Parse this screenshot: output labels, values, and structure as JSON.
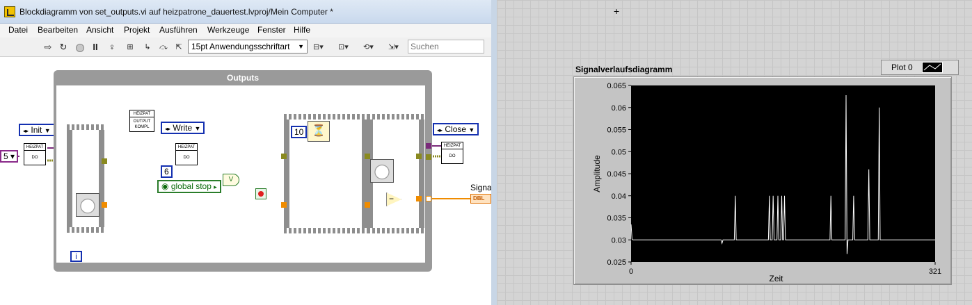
{
  "block_diagram": {
    "window_title": "Blockdiagramm von set_outputs.vi auf heizpatrone_dauertest.lvproj/Mein Computer *",
    "menu": [
      "Datei",
      "Bearbeiten",
      "Ansicht",
      "Projekt",
      "Ausführen",
      "Werkzeuge",
      "Fenster",
      "Hilfe"
    ],
    "toolbar": {
      "font_select": "15pt Anwendungsschriftart",
      "search_placeholder": "Suchen",
      "icons": [
        "run-arrow-icon",
        "run-continuous-icon",
        "abort-icon",
        "pause-icon",
        "highlight-bulb-icon",
        "retain-wire-icon",
        "step-into-icon",
        "step-over-icon",
        "step-out-icon",
        "align-icon",
        "distribute-icon",
        "resize-icon",
        "reorder-icon"
      ]
    },
    "diagram": {
      "loop_title": "Outputs",
      "init_enum": "Init",
      "write_enum": "Write",
      "close_enum": "Close",
      "subvi_label": "HEIZPAT",
      "subvi_sub": "DO",
      "output_subvi_line1": "OUTPUT",
      "output_subvi_line2": "KOMPL",
      "constant_six": "6",
      "constant_ten": "10",
      "global_stop": "global stop",
      "or_label": "V",
      "iteration_terminal": "i",
      "left_cut_constant": "5",
      "subtract_symbol": "−",
      "signal_label": "Signal",
      "signal_type": "DBL"
    }
  },
  "front_panel": {
    "graph_title": "Signalverlaufsdiagramm",
    "legend_plot": "Plot 0",
    "colors": {
      "plot_bg": "#000000",
      "trace": "#ffffff",
      "frame": "#c4c4c4"
    }
  },
  "chart_data": {
    "type": "line",
    "title": "Signalverlaufsdiagramm",
    "xlabel": "Zeit",
    "ylabel": "Amplitude",
    "xlim": [
      0,
      321
    ],
    "ylim": [
      0.025,
      0.065
    ],
    "x_ticks": [
      "0",
      "321"
    ],
    "y_ticks": [
      "0.025",
      "0.03",
      "0.035",
      "0.04",
      "0.045",
      "0.05",
      "0.055",
      "0.06",
      "0.065"
    ],
    "series": [
      {
        "name": "Plot 0",
        "baseline": 0.03,
        "points": [
          [
            0,
            0.0335
          ],
          [
            1,
            0.0302
          ],
          [
            2,
            0.03
          ],
          [
            50,
            0.03
          ],
          [
            95,
            0.03
          ],
          [
            96,
            0.0292
          ],
          [
            97,
            0.03
          ],
          [
            109,
            0.03
          ],
          [
            110,
            0.04
          ],
          [
            111,
            0.03
          ],
          [
            145,
            0.03
          ],
          [
            146,
            0.04
          ],
          [
            147,
            0.03
          ],
          [
            149,
            0.03
          ],
          [
            150,
            0.04
          ],
          [
            151,
            0.03
          ],
          [
            154,
            0.03
          ],
          [
            155,
            0.04
          ],
          [
            156,
            0.03
          ],
          [
            158,
            0.03
          ],
          [
            159,
            0.04
          ],
          [
            160,
            0.03
          ],
          [
            161,
            0.03
          ],
          [
            162,
            0.04
          ],
          [
            163,
            0.03
          ],
          [
            210,
            0.03
          ],
          [
            211,
            0.04
          ],
          [
            212,
            0.03
          ],
          [
            226,
            0.03
          ],
          [
            227,
            0.0628
          ],
          [
            228,
            0.0268
          ],
          [
            229,
            0.03
          ],
          [
            234,
            0.03
          ],
          [
            235,
            0.04
          ],
          [
            236,
            0.03
          ],
          [
            250,
            0.03
          ],
          [
            251,
            0.046
          ],
          [
            252,
            0.03
          ],
          [
            261,
            0.03
          ],
          [
            262,
            0.06
          ],
          [
            263,
            0.03
          ],
          [
            321,
            0.03
          ]
        ]
      }
    ]
  }
}
